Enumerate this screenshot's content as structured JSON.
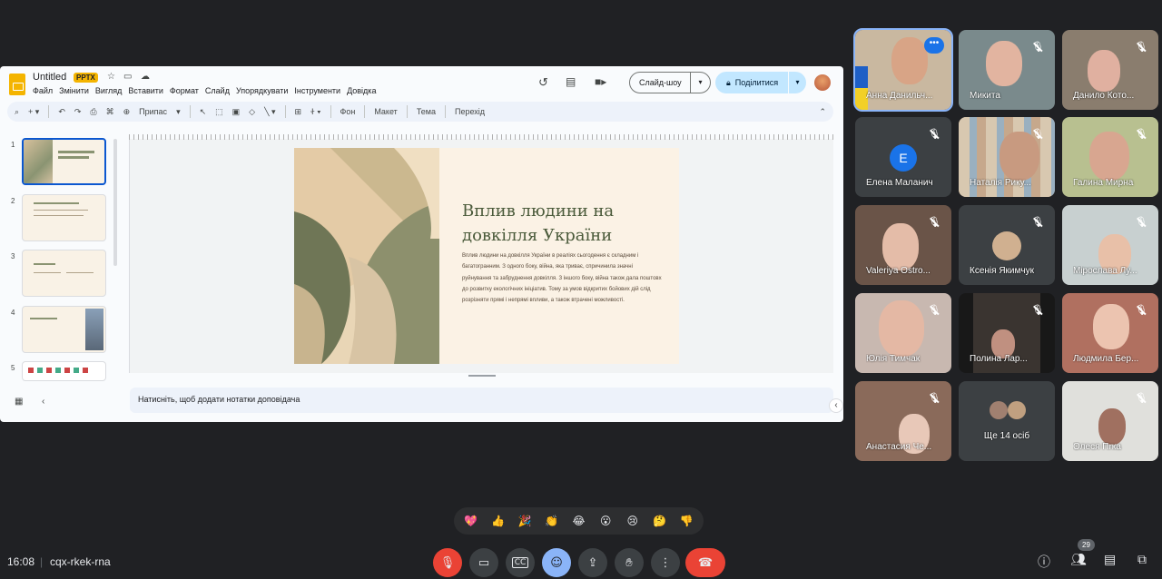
{
  "presentation": {
    "doc_title": "Untitled",
    "badge": "PPTX",
    "menu": [
      "Файл",
      "Змінити",
      "Вигляд",
      "Вставити",
      "Формат",
      "Слайд",
      "Упорядкувати",
      "Інструменти",
      "Довідка"
    ],
    "toolbar_labels": {
      "zoom_mode": "Припас",
      "background": "Фон",
      "layout": "Макет",
      "theme": "Тема",
      "transition": "Перехід"
    },
    "slideshow_label": "Слайд-шоу",
    "share_label": "Поділитися",
    "slide_numbers": [
      "1",
      "2",
      "3",
      "4",
      "5"
    ],
    "slide": {
      "heading": "Вплив людини на довкілля України",
      "body": "Вплив людини на довкілля України в реаліях сьогодення є складним і багатогранним. З одного боку, війна, яка триває, спричинила значні руйнування та забруднення довкілля. З іншого боку, війна також дала поштовх до розвитку екологічних ініціатив. Тому за умов відкритих бойових дій слід розрізняти прямі і непрямі впливи, а також втрачені можливості."
    },
    "notes_placeholder": "Натисніть, щоб додати нотатки доповідача"
  },
  "participants": [
    {
      "name": "Анна Данильч...",
      "muted": false,
      "speaking": true,
      "more": true
    },
    {
      "name": "Микита",
      "muted": true
    },
    {
      "name": "Данило Кото...",
      "muted": true
    },
    {
      "name": "Елена Маланич",
      "muted": true,
      "initial": "Е"
    },
    {
      "name": "Наталія Рику...",
      "muted": true
    },
    {
      "name": "Галина Мирна",
      "muted": true
    },
    {
      "name": "Valeriya Ostro...",
      "muted": true
    },
    {
      "name": "Ксенія Якимчук",
      "muted": true
    },
    {
      "name": "Мірослава Лу...",
      "muted": true
    },
    {
      "name": "Юлія Тимчак",
      "muted": true
    },
    {
      "name": "Полина Лар...",
      "muted": true
    },
    {
      "name": "Людмила Бер...",
      "muted": true
    },
    {
      "name": "Анастасия Че...",
      "muted": true
    },
    {
      "name": "Ще 14 осіб",
      "muted": false
    },
    {
      "name": "Олеся Пrка",
      "muted": true
    }
  ],
  "reactions": [
    "💖",
    "👍",
    "🎉",
    "👏",
    "😂",
    "😮",
    "😢",
    "🤔",
    "👎"
  ],
  "meeting": {
    "time": "16:08",
    "code": "cqx-rkek-rna",
    "people_count": "29"
  },
  "colors": {
    "background": "#202124",
    "accent": "#8ab4f8",
    "danger": "#ea4335",
    "slide_heading": "#4a5a3a"
  }
}
